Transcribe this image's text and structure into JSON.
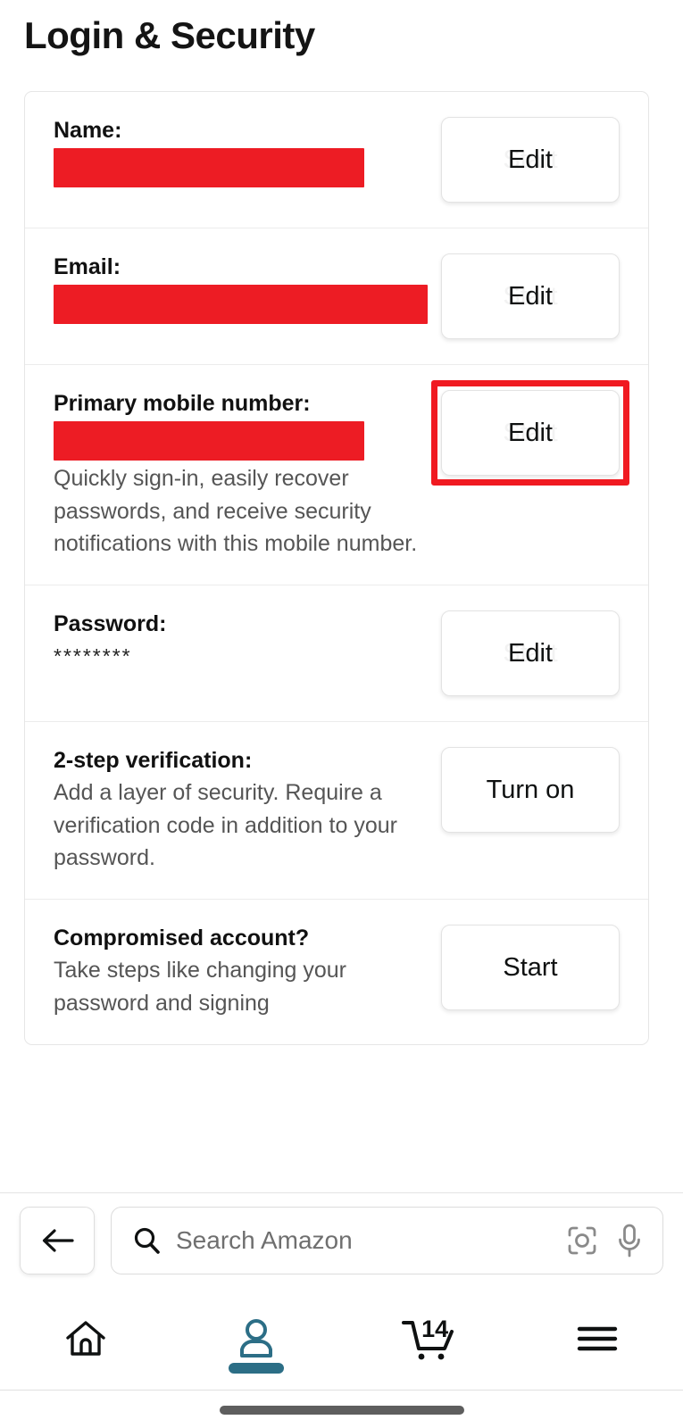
{
  "page": {
    "title": "Login & Security"
  },
  "sections": [
    {
      "id": "name",
      "label": "Name:",
      "value_redacted": true,
      "description": "",
      "button": {
        "label": "Edit",
        "ghost": "Start",
        "name": "edit-name-button"
      },
      "highlighted": false
    },
    {
      "id": "email",
      "label": "Email:",
      "value_redacted": true,
      "description": "",
      "button": {
        "label": "Edit",
        "ghost": "Start",
        "name": "edit-email-button"
      },
      "highlighted": false
    },
    {
      "id": "primary-mobile-number",
      "label": "Primary mobile number:",
      "value_redacted": true,
      "description": "Quickly sign-in, easily recover passwords, and receive security notifications with this mobile number.",
      "button": {
        "label": "Edit",
        "ghost": "Start",
        "name": "edit-mobile-number-button"
      },
      "highlighted": true
    },
    {
      "id": "password",
      "label": "Password:",
      "value_redacted": false,
      "value": "********",
      "description": "",
      "button": {
        "label": "Edit",
        "ghost": "Start",
        "name": "edit-password-button"
      },
      "highlighted": false
    },
    {
      "id": "two-step-verification",
      "label": "2-step verification:",
      "value_redacted": false,
      "description": "Add a layer of security. Require a verification code in addition to your password.",
      "button": {
        "label": "Turn on",
        "ghost": "",
        "name": "turn-on-2sv-button"
      },
      "highlighted": false
    },
    {
      "id": "compromised-account",
      "label": "Compromised account?",
      "value_redacted": false,
      "description": "Take steps like changing your password and signing",
      "button": {
        "label": "Start",
        "ghost": "",
        "name": "start-compromised-account-button"
      },
      "highlighted": false
    }
  ],
  "search": {
    "placeholder": "Search Amazon",
    "back_label": "Back",
    "search_icon": "search-icon",
    "camera_icon": "camera-lens-icon",
    "mic_icon": "microphone-icon"
  },
  "bottom_nav": {
    "items": [
      {
        "name": "nav-home",
        "icon": "home-icon",
        "active": false,
        "badge": ""
      },
      {
        "name": "nav-account",
        "icon": "person-icon",
        "active": true,
        "badge": ""
      },
      {
        "name": "nav-cart",
        "icon": "cart-icon",
        "active": false,
        "badge": "14"
      },
      {
        "name": "nav-menu",
        "icon": "hamburger-menu-icon",
        "active": false,
        "badge": ""
      }
    ]
  },
  "colors": {
    "redaction_red": "#ED1C24",
    "highlight_red": "#F01A21",
    "accent_teal": "#2C6E86",
    "text_primary": "#0f1111",
    "text_secondary": "#555555"
  }
}
